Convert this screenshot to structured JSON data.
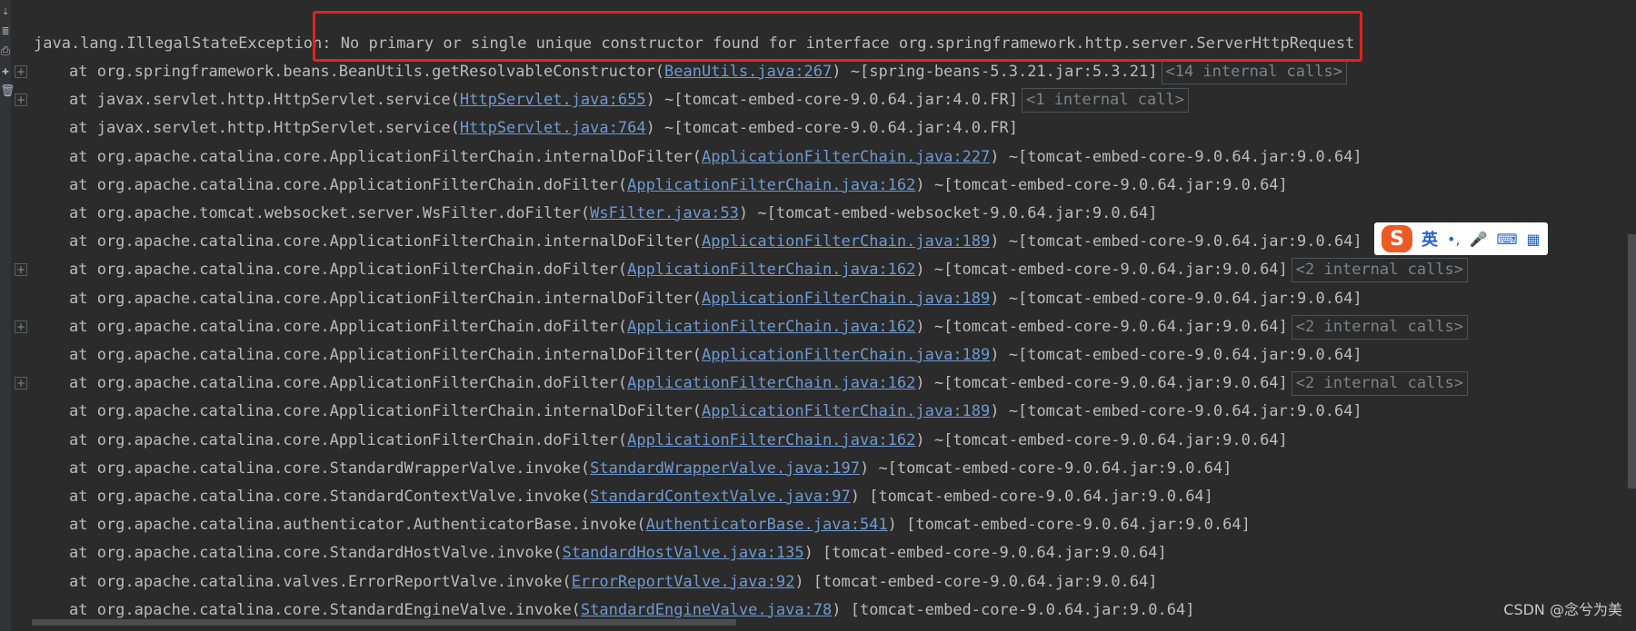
{
  "console": {
    "exception_class": "java.lang.IllegalStateException:",
    "exception_message": " No primary or single unique constructor found for interface org.springframework.http.server.ServerHttpRequest",
    "frames": [
      {
        "prefix": "at org.springframework.beans.BeanUtils.getResolvableConstructor(",
        "link": "BeanUtils.java:267",
        "suffix": ") ~[spring-beans-5.3.21.jar:5.3.21]",
        "calls": "<14 internal calls>",
        "fold": true
      },
      {
        "prefix": "at javax.servlet.http.HttpServlet.service(",
        "link": "HttpServlet.java:655",
        "suffix": ") ~[tomcat-embed-core-9.0.64.jar:4.0.FR]",
        "calls": "<1 internal call>",
        "fold": true
      },
      {
        "prefix": "at javax.servlet.http.HttpServlet.service(",
        "link": "HttpServlet.java:764",
        "suffix": ") ~[tomcat-embed-core-9.0.64.jar:4.0.FR]",
        "calls": "",
        "fold": false
      },
      {
        "prefix": "at org.apache.catalina.core.ApplicationFilterChain.internalDoFilter(",
        "link": "ApplicationFilterChain.java:227",
        "suffix": ") ~[tomcat-embed-core-9.0.64.jar:9.0.64]",
        "calls": "",
        "fold": false
      },
      {
        "prefix": "at org.apache.catalina.core.ApplicationFilterChain.doFilter(",
        "link": "ApplicationFilterChain.java:162",
        "suffix": ") ~[tomcat-embed-core-9.0.64.jar:9.0.64]",
        "calls": "",
        "fold": false
      },
      {
        "prefix": "at org.apache.tomcat.websocket.server.WsFilter.doFilter(",
        "link": "WsFilter.java:53",
        "suffix": ") ~[tomcat-embed-websocket-9.0.64.jar:9.0.64]",
        "calls": "",
        "fold": false
      },
      {
        "prefix": "at org.apache.catalina.core.ApplicationFilterChain.internalDoFilter(",
        "link": "ApplicationFilterChain.java:189",
        "suffix": ") ~[tomcat-embed-core-9.0.64.jar:9.0.64]",
        "calls": "",
        "fold": false
      },
      {
        "prefix": "at org.apache.catalina.core.ApplicationFilterChain.doFilter(",
        "link": "ApplicationFilterChain.java:162",
        "suffix": ") ~[tomcat-embed-core-9.0.64.jar:9.0.64]",
        "calls": "<2 internal calls>",
        "fold": true
      },
      {
        "prefix": "at org.apache.catalina.core.ApplicationFilterChain.internalDoFilter(",
        "link": "ApplicationFilterChain.java:189",
        "suffix": ") ~[tomcat-embed-core-9.0.64.jar:9.0.64]",
        "calls": "",
        "fold": false
      },
      {
        "prefix": "at org.apache.catalina.core.ApplicationFilterChain.doFilter(",
        "link": "ApplicationFilterChain.java:162",
        "suffix": ") ~[tomcat-embed-core-9.0.64.jar:9.0.64]",
        "calls": "<2 internal calls>",
        "fold": true
      },
      {
        "prefix": "at org.apache.catalina.core.ApplicationFilterChain.internalDoFilter(",
        "link": "ApplicationFilterChain.java:189",
        "suffix": ") ~[tomcat-embed-core-9.0.64.jar:9.0.64]",
        "calls": "",
        "fold": false
      },
      {
        "prefix": "at org.apache.catalina.core.ApplicationFilterChain.doFilter(",
        "link": "ApplicationFilterChain.java:162",
        "suffix": ") ~[tomcat-embed-core-9.0.64.jar:9.0.64]",
        "calls": "<2 internal calls>",
        "fold": true
      },
      {
        "prefix": "at org.apache.catalina.core.ApplicationFilterChain.internalDoFilter(",
        "link": "ApplicationFilterChain.java:189",
        "suffix": ") ~[tomcat-embed-core-9.0.64.jar:9.0.64]",
        "calls": "",
        "fold": false
      },
      {
        "prefix": "at org.apache.catalina.core.ApplicationFilterChain.doFilter(",
        "link": "ApplicationFilterChain.java:162",
        "suffix": ") ~[tomcat-embed-core-9.0.64.jar:9.0.64]",
        "calls": "",
        "fold": false
      },
      {
        "prefix": "at org.apache.catalina.core.StandardWrapperValve.invoke(",
        "link": "StandardWrapperValve.java:197",
        "suffix": ") ~[tomcat-embed-core-9.0.64.jar:9.0.64]",
        "calls": "",
        "fold": false
      },
      {
        "prefix": "at org.apache.catalina.core.StandardContextValve.invoke(",
        "link": "StandardContextValve.java:97",
        "suffix": ") [tomcat-embed-core-9.0.64.jar:9.0.64]",
        "calls": "",
        "fold": false
      },
      {
        "prefix": "at org.apache.catalina.authenticator.AuthenticatorBase.invoke(",
        "link": "AuthenticatorBase.java:541",
        "suffix": ") [tomcat-embed-core-9.0.64.jar:9.0.64]",
        "calls": "",
        "fold": false
      },
      {
        "prefix": "at org.apache.catalina.core.StandardHostValve.invoke(",
        "link": "StandardHostValve.java:135",
        "suffix": ") [tomcat-embed-core-9.0.64.jar:9.0.64]",
        "calls": "",
        "fold": false
      },
      {
        "prefix": "at org.apache.catalina.valves.ErrorReportValve.invoke(",
        "link": "ErrorReportValve.java:92",
        "suffix": ") [tomcat-embed-core-9.0.64.jar:9.0.64]",
        "calls": "",
        "fold": false
      },
      {
        "prefix": "at org.apache.catalina.core.StandardEngineValve.invoke(",
        "link": "StandardEngineValve.java:78",
        "suffix": ") [tomcat-embed-core-9.0.64.jar:9.0.64]",
        "calls": "",
        "fold": false
      }
    ]
  },
  "gutter": {
    "icons": [
      "arrow-down-icon",
      "ruler-icon",
      "print-icon",
      "pin-icon",
      "trash-icon"
    ],
    "glyphs": [
      "⇣",
      "≣",
      "⎙",
      "✚",
      "🗑"
    ]
  },
  "ime_toolbar": {
    "logo": "S",
    "lang": "英",
    "punct": "•,",
    "icons": [
      "microphone-icon",
      "keyboard-icon",
      "apps-icon"
    ],
    "glyphs": [
      "🎤",
      "⌨",
      "▦"
    ]
  },
  "watermark": "CSDN @念兮为美",
  "colors": {
    "background": "#2b2b2b",
    "text": "#bbbbbb",
    "link": "#6f9ad1",
    "highlight": "#e0231f",
    "ime_logo": "#ee5a24"
  }
}
